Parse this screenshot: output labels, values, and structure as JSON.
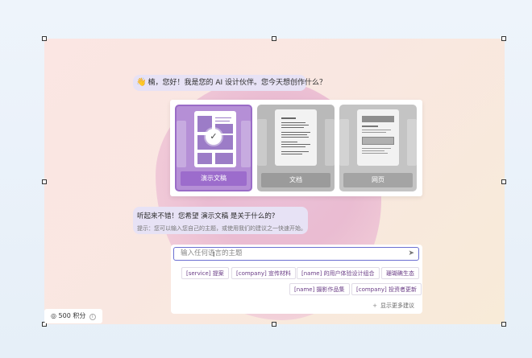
{
  "chat": {
    "greeting_emoji": "👋",
    "greeting": "楠，您好！我是您的 AI 设计伙伴。您今天想创作什么？",
    "followup": "听起来不错！您希望 演示文稿 是关于什么的?",
    "hint": "提示：您可以输入您自己的主题，或使用我们的建议之一快速开始。"
  },
  "cards": [
    {
      "label": "演示文稿",
      "selected": true
    },
    {
      "label": "文档",
      "selected": false
    },
    {
      "label": "网页",
      "selected": false
    }
  ],
  "input": {
    "placeholder": "输入任何语言的主题",
    "send_icon": "send-icon"
  },
  "suggestions": [
    "[service] 提案",
    "[company] 宣传材料",
    "[name] 的用户体验设计组合",
    "珊瑚礁生态",
    "[name] 摄影作品集",
    "[company] 投资者更新"
  ],
  "show_more": "显示更多建议",
  "credits": {
    "label": "500 积分"
  },
  "colors": {
    "accent": "#9c6ccc",
    "input_border": "#6b6fd1"
  }
}
